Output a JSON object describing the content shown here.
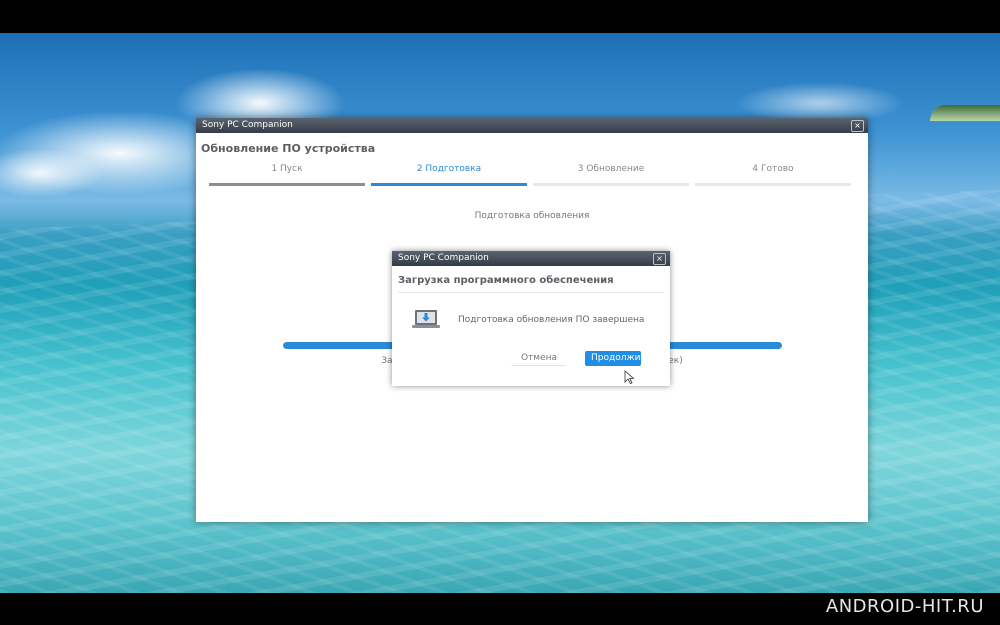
{
  "main_window": {
    "title": "Sony PC Companion",
    "close_label": "×",
    "heading": "Обновление ПО устройства",
    "steps": [
      {
        "label": "1  Пуск",
        "state": "done"
      },
      {
        "label": "2  Подготовка",
        "state": "active"
      },
      {
        "label": "3  Обновление",
        "state": "pending"
      },
      {
        "label": "4  Готово",
        "state": "pending"
      }
    ],
    "status": "Подготовка обновления",
    "progress_fraction": 1.0,
    "progress_caption": "Загр                                                                                           сек)"
  },
  "dialog": {
    "title": "Sony PC Companion",
    "close_label": "×",
    "heading": "Загрузка программного обеспечения",
    "icon": "laptop-download-icon",
    "message": "Подготовка обновления ПО завершена",
    "cancel_label": "Отмена",
    "continue_label": "Продолжить"
  },
  "watermark": "ANDROID-HIT.RU",
  "colors": {
    "accent": "#2a8ad6",
    "button": "#1f8ee4",
    "titlebar": "#3c4550"
  }
}
